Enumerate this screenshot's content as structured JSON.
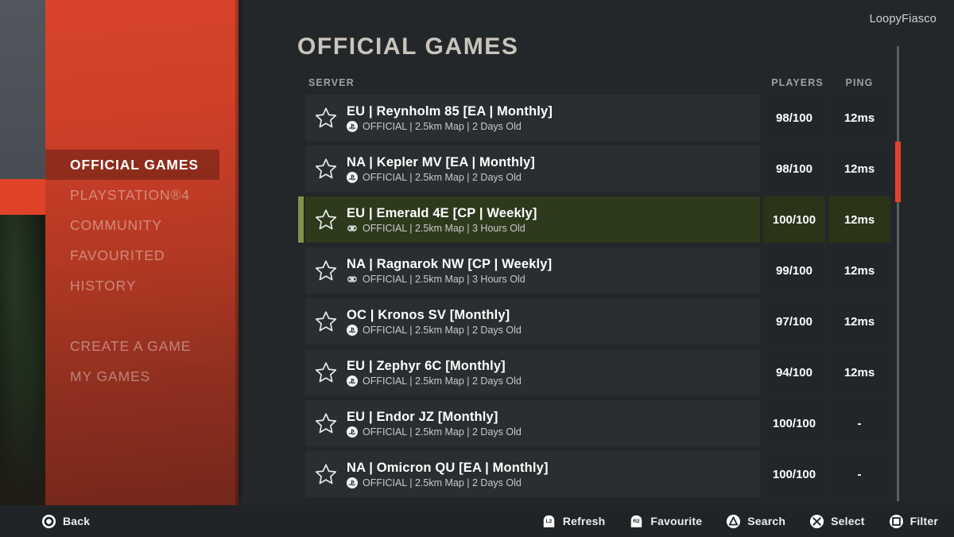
{
  "user": {
    "name": "LoopyFiasco"
  },
  "page": {
    "title": "OFFICIAL GAMES"
  },
  "colors": {
    "sidebar_red": "#d8432c",
    "accent_red": "#e0432b",
    "selected_green": "#2e3a1c",
    "selected_accent": "#7e9448",
    "panel_dark": "#232729",
    "row_bg": "#2a2e30"
  },
  "sidebar": {
    "items": [
      {
        "label": "OFFICIAL GAMES",
        "active": true,
        "name": "sidebar-item-official-games"
      },
      {
        "label": "PLAYSTATION®4",
        "active": false,
        "name": "sidebar-item-playstation4"
      },
      {
        "label": "COMMUNITY",
        "active": false,
        "name": "sidebar-item-community"
      },
      {
        "label": "FAVOURITED",
        "active": false,
        "name": "sidebar-item-favourited"
      },
      {
        "label": "HISTORY",
        "active": false,
        "name": "sidebar-item-history"
      }
    ],
    "items2": [
      {
        "label": "CREATE A GAME",
        "active": false,
        "name": "sidebar-item-create-a-game"
      },
      {
        "label": "MY GAMES",
        "active": false,
        "name": "sidebar-item-my-games"
      }
    ]
  },
  "table": {
    "columns": {
      "server": "SERVER",
      "players": "PLAYERS",
      "ping": "PING"
    },
    "rows": [
      {
        "name": "EU | Reynholm 85 [EA | Monthly]",
        "meta": "OFFICIAL | 2.5km Map | 2 Days Old",
        "platform_icon": "playstation-icon",
        "players": "98/100",
        "ping": "12ms",
        "selected": false,
        "favourited": false
      },
      {
        "name": "NA | Kepler MV [EA | Monthly]",
        "meta": "OFFICIAL | 2.5km Map | 2 Days Old",
        "platform_icon": "playstation-icon",
        "players": "98/100",
        "ping": "12ms",
        "selected": false,
        "favourited": false
      },
      {
        "name": "EU | Emerald 4E [CP | Weekly]",
        "meta": "OFFICIAL | 2.5km Map | 3 Hours Old",
        "platform_icon": "crossplay-icon",
        "players": "100/100",
        "ping": "12ms",
        "selected": true,
        "favourited": false
      },
      {
        "name": "NA | Ragnarok NW [CP | Weekly]",
        "meta": "OFFICIAL | 2.5km Map | 3 Hours Old",
        "platform_icon": "crossplay-icon",
        "players": "99/100",
        "ping": "12ms",
        "selected": false,
        "favourited": false
      },
      {
        "name": "OC | Kronos SV [Monthly]",
        "meta": "OFFICIAL | 2.5km Map | 2 Days Old",
        "platform_icon": "playstation-icon",
        "players": "97/100",
        "ping": "12ms",
        "selected": false,
        "favourited": false
      },
      {
        "name": "EU | Zephyr 6C [Monthly]",
        "meta": "OFFICIAL | 2.5km Map | 2 Days Old",
        "platform_icon": "playstation-icon",
        "players": "94/100",
        "ping": "12ms",
        "selected": false,
        "favourited": false
      },
      {
        "name": "EU | Endor JZ [Monthly]",
        "meta": "OFFICIAL | 2.5km Map | 2 Days Old",
        "platform_icon": "playstation-icon",
        "players": "100/100",
        "ping": "-",
        "selected": false,
        "favourited": false
      },
      {
        "name": "NA | Omicron QU [EA | Monthly]",
        "meta": "OFFICIAL | 2.5km Map | 2 Days Old",
        "platform_icon": "playstation-icon",
        "players": "100/100",
        "ping": "-",
        "selected": false,
        "favourited": false
      }
    ]
  },
  "bottom_bar": {
    "back": {
      "label": "Back",
      "glyph": "ps-circle-icon"
    },
    "prompts": [
      {
        "label": "Refresh",
        "glyph": "l2-trigger-icon"
      },
      {
        "label": "Favourite",
        "glyph": "r2-trigger-icon"
      },
      {
        "label": "Search",
        "glyph": "ps-triangle-icon"
      },
      {
        "label": "Select",
        "glyph": "ps-cross-icon"
      },
      {
        "label": "Filter",
        "glyph": "ps-square-icon"
      }
    ]
  },
  "scrollbar": {
    "position_percent": 21
  }
}
